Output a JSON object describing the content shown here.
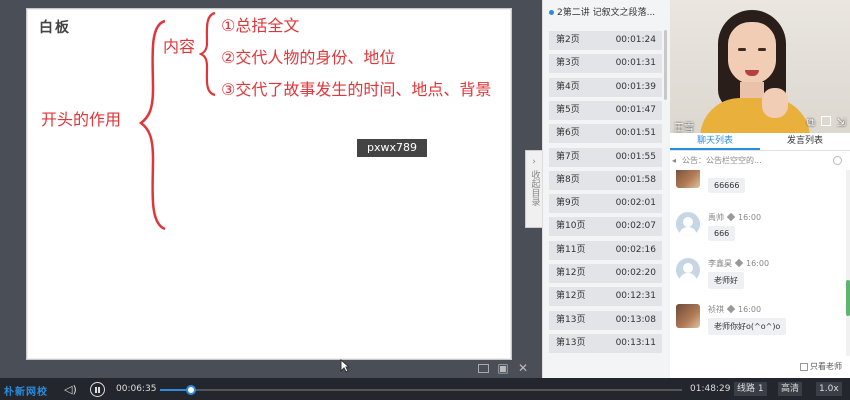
{
  "board": {
    "title": "白板",
    "handwriting": {
      "kaitou": "开头的作用",
      "neirong": "内容",
      "line1": "①总括全文",
      "line2": "②交代人物的身份、地位",
      "line3": "③交代了故事发生的时间、地点、背景"
    },
    "watermark": "pxwx789",
    "handwriting_color": "#e0363a"
  },
  "collapse_tab": {
    "label": "收起目录"
  },
  "page_list": {
    "lesson_title": "2第二讲 记叙文之段落...",
    "pages": [
      {
        "page": "第2页",
        "time": "00:01:24"
      },
      {
        "page": "第3页",
        "time": "00:01:31"
      },
      {
        "page": "第4页",
        "time": "00:01:39"
      },
      {
        "page": "第5页",
        "time": "00:01:47"
      },
      {
        "page": "第6页",
        "time": "00:01:51"
      },
      {
        "page": "第7页",
        "time": "00:01:55"
      },
      {
        "page": "第8页",
        "time": "00:01:58"
      },
      {
        "page": "第9页",
        "time": "00:02:01"
      },
      {
        "page": "第10页",
        "time": "00:02:07"
      },
      {
        "page": "第11页",
        "time": "00:02:16"
      },
      {
        "page": "第12页",
        "time": "00:02:20"
      },
      {
        "page": "第12页",
        "time": "00:12:31"
      },
      {
        "page": "第13页",
        "time": "00:13:08"
      },
      {
        "page": "第13页",
        "time": "00:13:11"
      }
    ]
  },
  "video": {
    "teacher_name": "王雪",
    "icons": [
      "popout-icon",
      "fullscreen-icon",
      "minimize-icon"
    ]
  },
  "chat": {
    "tabs": [
      "聊天列表",
      "发言列表"
    ],
    "notice": "公告：公告栏空空的...",
    "messages": [
      {
        "name": "",
        "time": "",
        "text": "66666",
        "avatar": "photo"
      },
      {
        "name": "禹帅",
        "time": "16:00",
        "text": "666",
        "avatar": "default"
      },
      {
        "name": "李鑫昊",
        "time": "16:00",
        "text": "老师好",
        "avatar": "default"
      },
      {
        "name": "祯祺",
        "time": "16:00",
        "text": "老师你好o(^o^)o",
        "avatar": "photo"
      }
    ],
    "only_teacher_label": "只看老师"
  },
  "controls": {
    "brand": "朴新网校",
    "current_time": "00:06:35",
    "total_time": "01:48:29",
    "progress": 0.06,
    "line_label": "线路 1",
    "quality_label": "高清",
    "speed_label": "1.0x",
    "accent_color": "#2b8cde"
  }
}
